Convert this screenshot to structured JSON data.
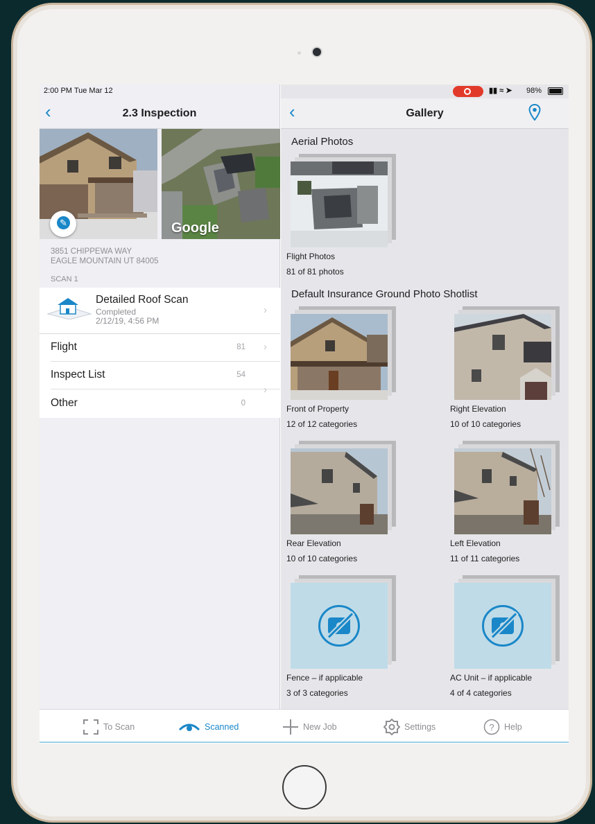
{
  "status": {
    "time": "2:00 PM  Tue Mar 12",
    "battery": "98%"
  },
  "left": {
    "title": "2.3 Inspection",
    "address_line1": "3851 CHIPPEWA WAY",
    "address_line2": "EAGLE MOUNTAIN UT 84005",
    "map_brand": "Google",
    "scan_label": "SCAN 1",
    "scan": {
      "title": "Detailed Roof Scan",
      "status": "Completed",
      "date": "2/12/19, 4:56 PM"
    },
    "rows": [
      {
        "label": "Flight",
        "count": "81"
      },
      {
        "label": "Inspect List",
        "count": "54"
      },
      {
        "label": "Other",
        "count": "0"
      }
    ]
  },
  "right": {
    "title": "Gallery",
    "aerial_title": "Aerial Photos",
    "aerial": {
      "name": "Flight Photos",
      "count": "81 of 81 photos"
    },
    "ground_title": "Default Insurance Ground Photo Shotlist",
    "tiles": [
      {
        "name": "Front of Property",
        "count": "12 of 12 categories"
      },
      {
        "name": "Right Elevation",
        "count": "10 of 10 categories"
      },
      {
        "name": "Rear Elevation",
        "count": "10 of 10 categories"
      },
      {
        "name": "Left Elevation",
        "count": "11 of 11 categories"
      },
      {
        "name": "Fence – if applicable",
        "count": "3 of 3 categories"
      },
      {
        "name": "AC Unit – if applicable",
        "count": "4 of 4 categories"
      }
    ]
  },
  "tabs": [
    {
      "label": "To Scan"
    },
    {
      "label": "Scanned"
    },
    {
      "label": "New Job"
    },
    {
      "label": "Settings"
    },
    {
      "label": "Help"
    }
  ],
  "colors": {
    "accent": "#1a87c8",
    "record": "#e23a2a"
  }
}
